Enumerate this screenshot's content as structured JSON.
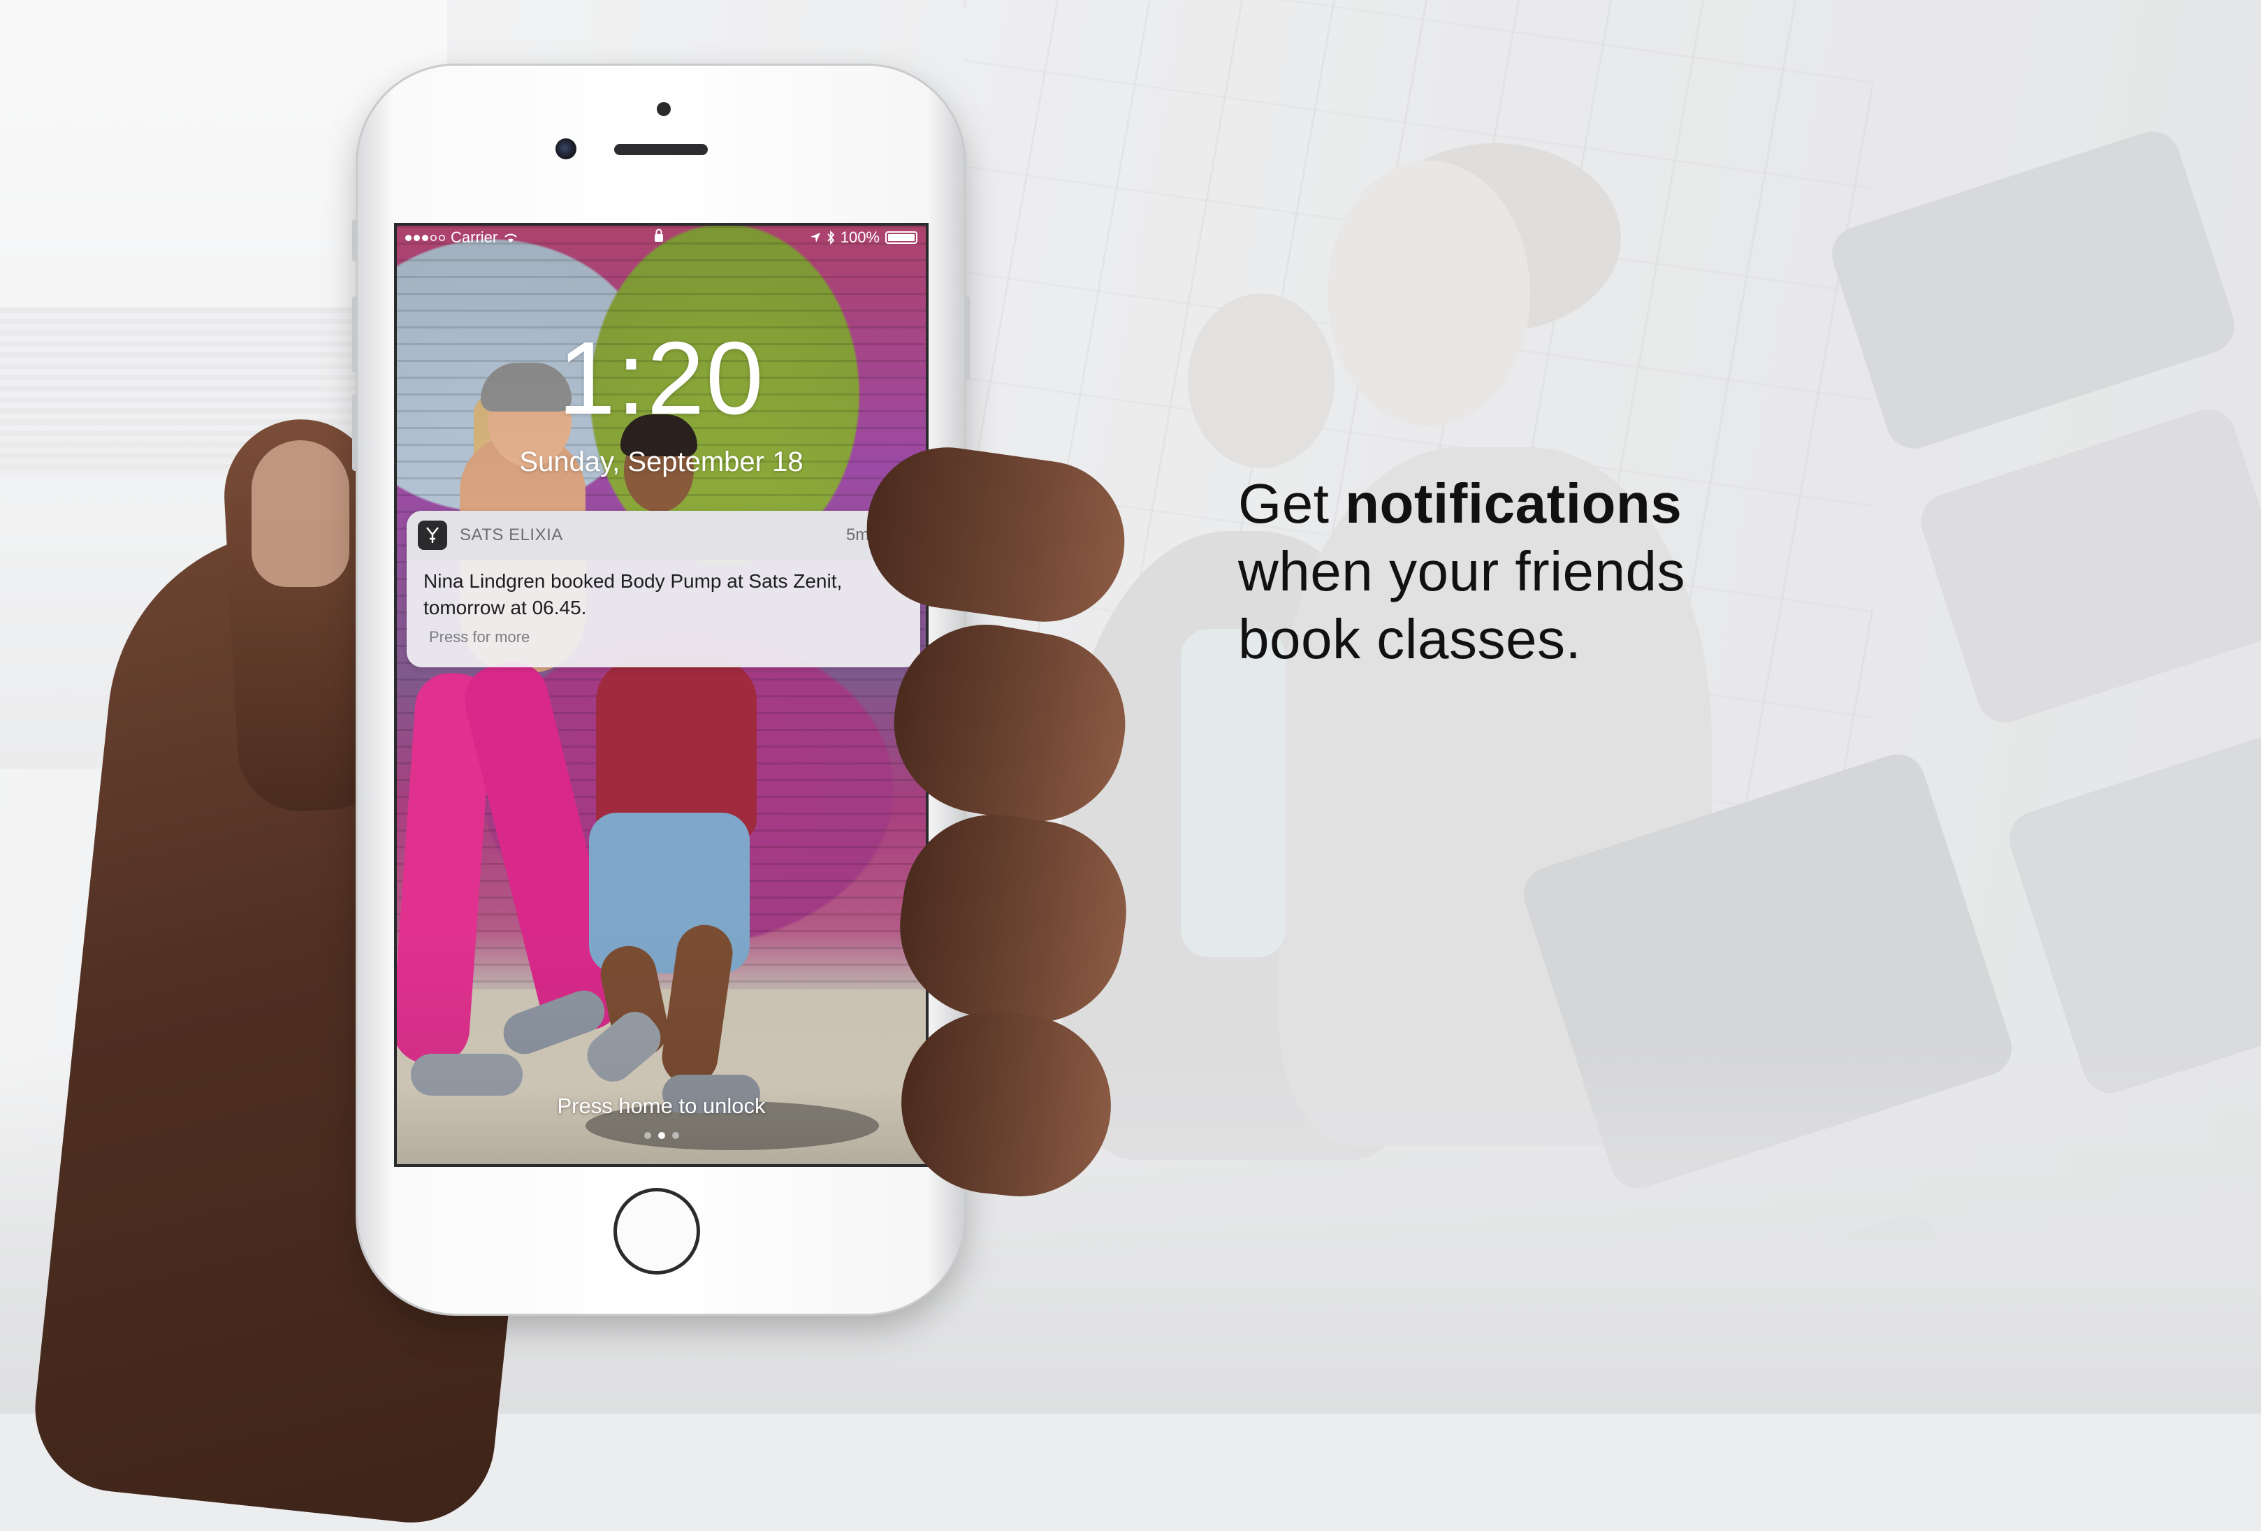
{
  "headline": {
    "lead": "Get ",
    "emphasis": "notifications",
    "line2": "when your friends",
    "line3": "book classes."
  },
  "status_bar": {
    "carrier": "Carrier",
    "battery": "100%",
    "icons": [
      "signal-dots-icon",
      "wifi-icon",
      "lock-icon",
      "location-icon",
      "bluetooth-icon",
      "battery-icon"
    ]
  },
  "lock_screen": {
    "time": "1:20",
    "date": "Sunday, September 18",
    "unlock_hint": "Press home to unlock",
    "page_dots": 3,
    "active_page": 2
  },
  "notification": {
    "app_name": "SATS ELIXIA",
    "time_ago": "5m ago",
    "message": "Nina Lindgren booked Body Pump at Sats Zenit, tomorrow at 06.45.",
    "action_hint": "Press for more"
  },
  "colors": {
    "headline_text": "#111111",
    "notification_bg": "#F0F0F3",
    "phone_body": "#FFFFFF"
  }
}
